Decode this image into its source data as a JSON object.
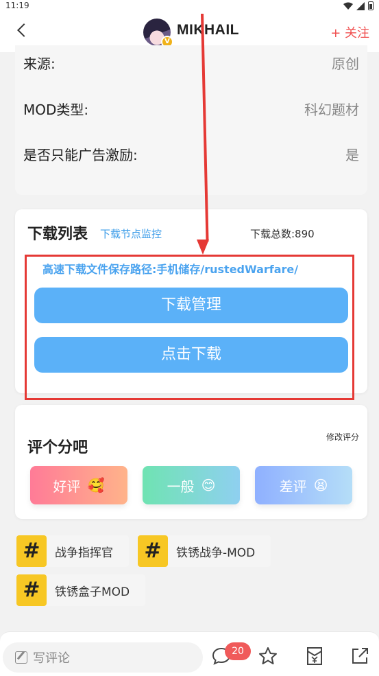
{
  "status": {
    "time": "11:19"
  },
  "header": {
    "username": "MIKHAIL",
    "follow_label": "+ 关注",
    "badge": "V"
  },
  "info": [
    {
      "key": "来源:",
      "value": "原创"
    },
    {
      "key": "MOD类型:",
      "value": "科幻题材"
    },
    {
      "key": "是否只能广告激励:",
      "value": "是"
    }
  ],
  "download": {
    "title": "下载列表",
    "monitor_link": "下载节点监控",
    "total_label": "下载总数:890",
    "path": "高速下载文件保存路径:手机储存/rustedWarfare/",
    "manage_button": "下载管理",
    "download_button": "点击下载"
  },
  "rating": {
    "title": "评个分吧",
    "edit_label": "修改评分",
    "good": "好评",
    "good_emoji": "🥰",
    "mid": "一般",
    "mid_emoji": "😊",
    "bad": "差评",
    "bad_emoji": "😫"
  },
  "tags": [
    {
      "hash": "#",
      "label": "战争指挥官"
    },
    {
      "hash": "#",
      "label": "铁锈战争-MOD"
    },
    {
      "hash": "#",
      "label": "铁锈盒子MOD"
    }
  ],
  "bottom": {
    "comment_placeholder": "写评论",
    "comment_count": "20"
  },
  "colors": {
    "accent_blue": "#5bb1f8",
    "follow_red": "#f05050",
    "annotation_red": "#e53935",
    "tag_yellow": "#f7c724"
  }
}
